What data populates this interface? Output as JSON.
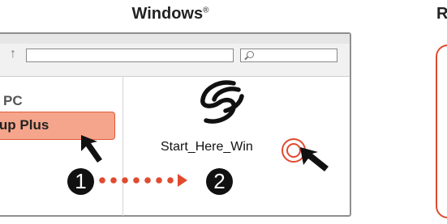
{
  "header": {
    "title": "Windows",
    "trademark": "®",
    "right_title_fragment": "R"
  },
  "window": {
    "nav": {
      "up_icon": "up-arrow-icon",
      "search_icon": "search-icon"
    },
    "sidebar": {
      "pc_label": "PC",
      "drive_label": "ckup Plus"
    },
    "content": {
      "file_label": "Start_Here_Win",
      "logo": "seagate-logo-icon"
    }
  },
  "steps": [
    {
      "label": "1"
    },
    {
      "label": "2"
    }
  ],
  "colors": {
    "accent": "#e04a2f",
    "highlight_fill": "#f4a58b",
    "dots": "#e04a2f",
    "step_bg": "#111111"
  }
}
